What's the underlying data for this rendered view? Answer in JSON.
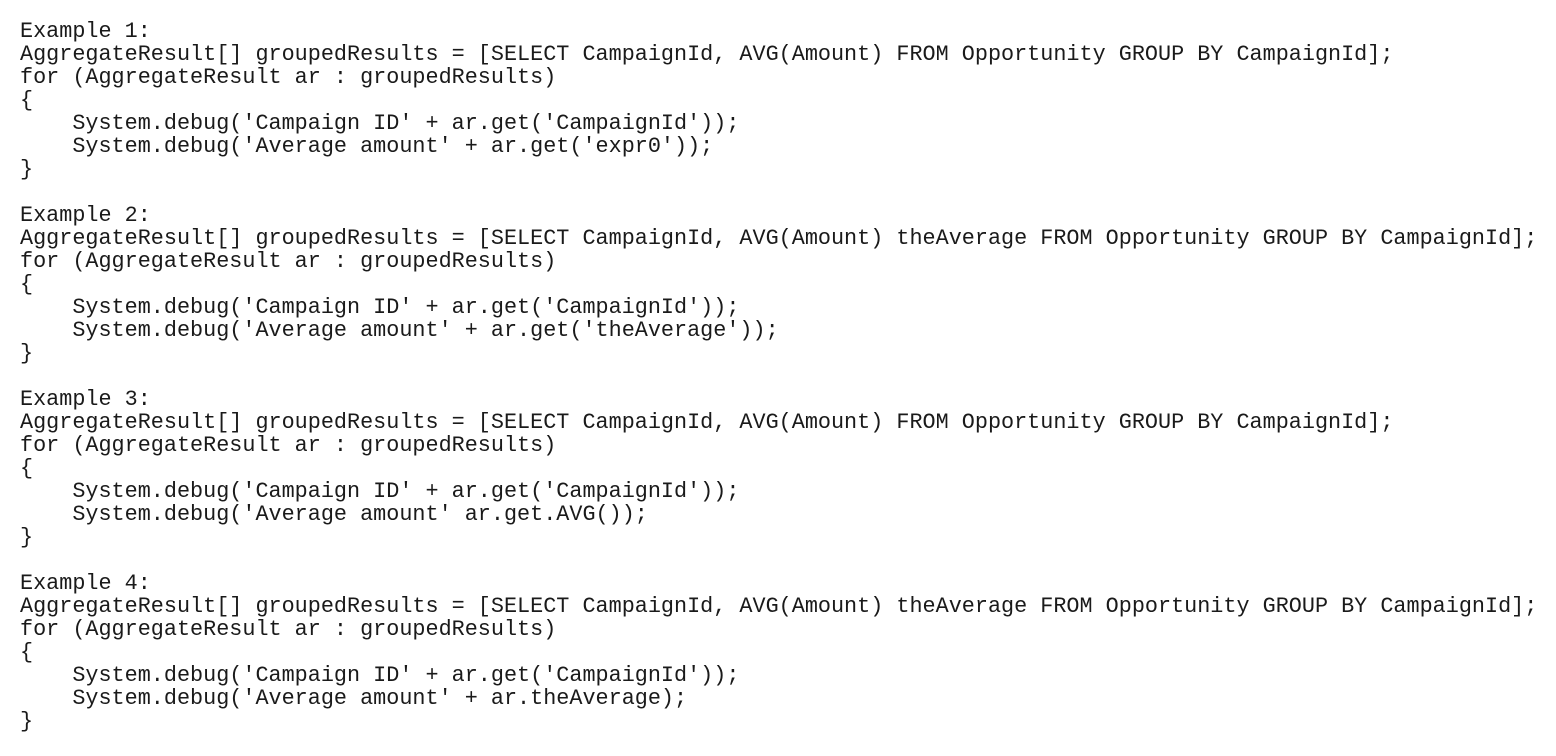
{
  "examples": [
    {
      "title": "Example 1:",
      "lines": [
        "AggregateResult[] groupedResults = [SELECT CampaignId, AVG(Amount) FROM Opportunity GROUP BY CampaignId];",
        "for (AggregateResult ar : groupedResults)",
        "{",
        "    System.debug('Campaign ID' + ar.get('CampaignId'));",
        "    System.debug('Average amount' + ar.get('expr0'));",
        "}"
      ]
    },
    {
      "title": "Example 2:",
      "lines": [
        "AggregateResult[] groupedResults = [SELECT CampaignId, AVG(Amount) theAverage FROM Opportunity GROUP BY CampaignId];",
        "for (AggregateResult ar : groupedResults)",
        "{",
        "    System.debug('Campaign ID' + ar.get('CampaignId'));",
        "    System.debug('Average amount' + ar.get('theAverage'));",
        "}"
      ]
    },
    {
      "title": "Example 3:",
      "lines": [
        "AggregateResult[] groupedResults = [SELECT CampaignId, AVG(Amount) FROM Opportunity GROUP BY CampaignId];",
        "for (AggregateResult ar : groupedResults)",
        "{",
        "    System.debug('Campaign ID' + ar.get('CampaignId'));",
        "    System.debug('Average amount' ar.get.AVG());",
        "}"
      ]
    },
    {
      "title": "Example 4:",
      "lines": [
        "AggregateResult[] groupedResults = [SELECT CampaignId, AVG(Amount) theAverage FROM Opportunity GROUP BY CampaignId];",
        "for (AggregateResult ar : groupedResults)",
        "{",
        "    System.debug('Campaign ID' + ar.get('CampaignId'));",
        "    System.debug('Average amount' + ar.theAverage);",
        "}"
      ]
    }
  ]
}
